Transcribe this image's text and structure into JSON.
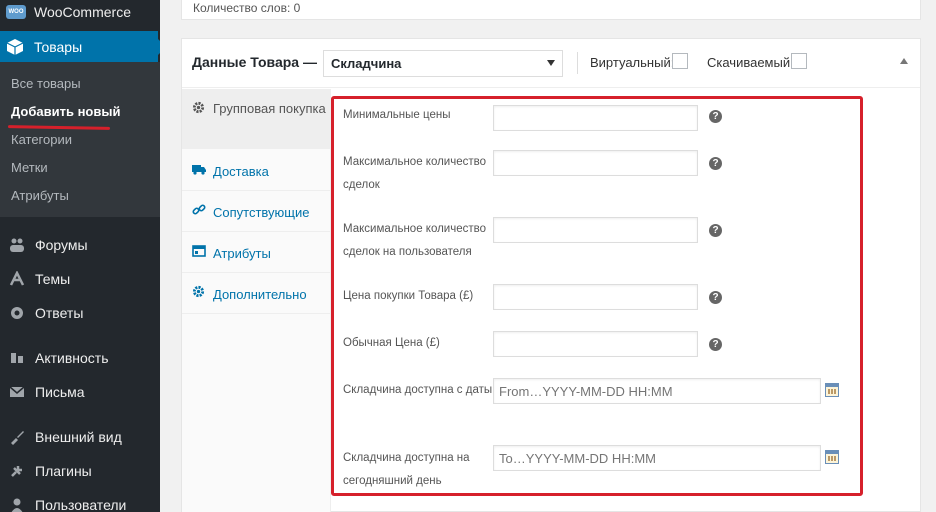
{
  "sidebar": {
    "brand": "WooCommerce",
    "brand_logo": "WOO",
    "active_menu": "Товары",
    "submenu": [
      "Все товары",
      "Добавить новый",
      "Категории",
      "Метки",
      "Атрибуты"
    ],
    "menu_items": [
      {
        "label": "Форумы",
        "icon": "forums-icon"
      },
      {
        "label": "Темы",
        "icon": "topics-icon"
      },
      {
        "label": "Ответы",
        "icon": "replies-icon"
      },
      {
        "label": "Активность",
        "icon": "activity-icon"
      },
      {
        "label": "Письма",
        "icon": "emails-icon"
      },
      {
        "label": "Внешний вид",
        "icon": "appearance-icon"
      },
      {
        "label": "Плагины",
        "icon": "plugins-icon"
      },
      {
        "label": "Пользователи",
        "icon": "users-icon"
      }
    ],
    "accent_color": "#0073aa",
    "background_color": "#23282d"
  },
  "editor": {
    "word_count": "Количество слов: 0"
  },
  "product_data": {
    "title": "Данные Товара —",
    "type_selected": "Складчина",
    "virtual_label": "Виртуальный:",
    "downloadable_label": "Скачиваемый:",
    "tabs": [
      {
        "label": "Групповая покупка",
        "icon": "gear-icon",
        "active": true
      },
      {
        "label": "Доставка",
        "icon": "truck-icon"
      },
      {
        "label": "Сопутствующие",
        "icon": "link-icon"
      },
      {
        "label": "Атрибуты",
        "icon": "table-icon"
      },
      {
        "label": "Дополнительно",
        "icon": "gear-icon"
      }
    ],
    "fields": [
      {
        "label": "Минимальные цены",
        "value": "",
        "help": "?"
      },
      {
        "label": "Максимальное количество сделок",
        "value": "",
        "help": "?"
      },
      {
        "label": "Максимальное количество сделок на пользователя",
        "value": "",
        "help": "?"
      },
      {
        "label": "Цена покупки Товара (£)",
        "value": "",
        "help": "?"
      },
      {
        "label": "Обычная Цена (£)",
        "value": "",
        "help": "?"
      },
      {
        "label": "Складчина доступна с даты",
        "placeholder": "From…YYYY-MM-DD HH:MM",
        "icon": "calendar-icon"
      },
      {
        "label": "Складчина доступна на сегодняшний день",
        "placeholder": "To…YYYY-MM-DD HH:MM",
        "icon": "calendar-icon"
      }
    ],
    "highlight_color": "#d6202b"
  }
}
